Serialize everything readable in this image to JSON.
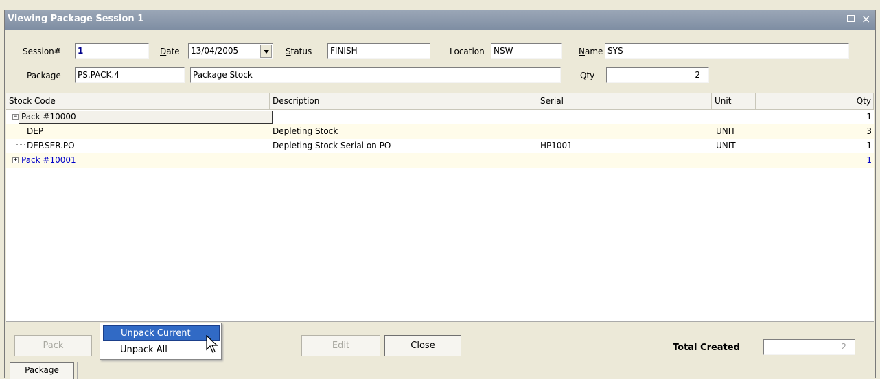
{
  "window": {
    "title": "Viewing Package Session 1",
    "maximize_icon": "maximize-icon",
    "close_glyph": "×"
  },
  "header": {
    "session_label_pre": "Session#",
    "session_value": "1",
    "date_label_u": "D",
    "date_label_rest": "ate",
    "date_value": "13/04/2005",
    "status_label_u": "S",
    "status_label_rest": "tatus",
    "status_value": "FINISH",
    "location_label": "Location",
    "location_value": "NSW",
    "name_label_u": "N",
    "name_label_rest": "ame",
    "name_value": "SYS",
    "package_label": "Package",
    "package_code": "PS.PACK.4",
    "package_desc": "Package Stock",
    "qty_label": "Qty",
    "qty_value": "2"
  },
  "grid": {
    "columns": [
      "Stock Code",
      "Description",
      "Serial",
      "Unit",
      "Qty"
    ],
    "rows": [
      {
        "stock_code": "Pack #10000",
        "description": "",
        "serial": "",
        "unit": "",
        "qty": "1",
        "expander": "−"
      },
      {
        "stock_code": "DEP",
        "description": "Depleting Stock",
        "serial": "",
        "unit": "UNIT",
        "qty": "3"
      },
      {
        "stock_code": "DEP.SER.PO",
        "description": "Depleting Stock Serial on PO",
        "serial": "HP1001",
        "unit": "UNIT",
        "qty": "1"
      },
      {
        "stock_code": "Pack #10001",
        "description": "",
        "serial": "",
        "unit": "",
        "qty": "1",
        "expander": "+"
      }
    ]
  },
  "buttons": {
    "pack_u": "P",
    "pack_rest": "ack",
    "edit": "Edit",
    "close": "Close"
  },
  "context_menu": {
    "items": [
      "Unpack Current",
      "Unpack All"
    ]
  },
  "totals": {
    "label": "Total Created",
    "value": "2"
  },
  "tabs": {
    "package": "Package"
  },
  "colors": {
    "title_bar": "#8594a8",
    "highlight": "#316ac5",
    "link_blue": "#0000c8",
    "alt_row": "#fffcea"
  }
}
